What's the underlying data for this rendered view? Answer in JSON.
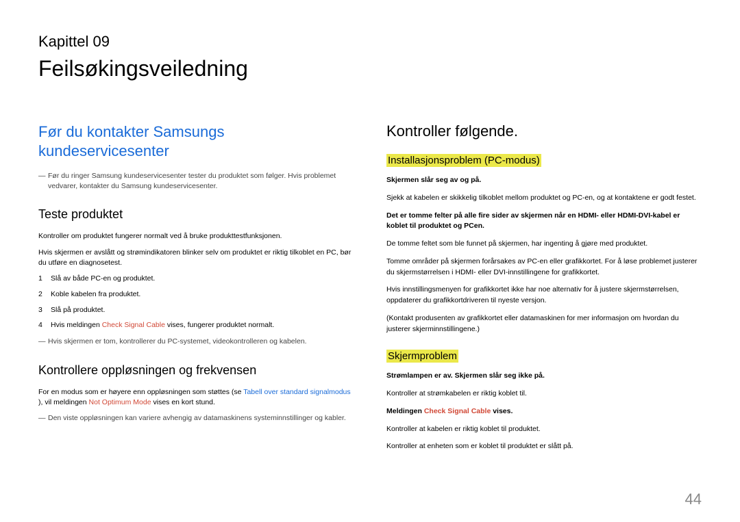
{
  "chapter": "Kapittel 09",
  "title": "Feilsøkingsveiledning",
  "left": {
    "h2": "Før du kontakter Samsungs kundeservicesenter",
    "note1": "Før du ringer Samsung kundeservicesenter tester du produktet som følger. Hvis problemet vedvarer, kontakter du Samsung kundeservicesenter.",
    "h3a": "Teste produktet",
    "p1": "Kontroller om produktet fungerer normalt ved å bruke produkttestfunksjonen.",
    "p2": "Hvis skjermen er avslått og strømindikatoren blinker selv om produktet er riktig tilkoblet en PC, bør du utføre en diagnosetest.",
    "steps": [
      "Slå av både PC-en og produktet.",
      "Koble kabelen fra produktet.",
      "Slå på produktet."
    ],
    "step4_pre": "Hvis meldingen ",
    "step4_red": "Check Signal Cable",
    "step4_post": " vises, fungerer produktet normalt.",
    "note2": "Hvis skjermen er tom, kontrollerer du PC-systemet, videokontrolleren og kabelen.",
    "h3b": "Kontrollere oppløsningen og frekvensen",
    "p3_pre": "For en modus som er høyere enn oppløsningen som støttes (se ",
    "p3_link": "Tabell over standard signalmodus",
    "p3_mid": " ), vil meldingen ",
    "p3_red": "Not Optimum Mode",
    "p3_post": " vises en kort stund.",
    "note3": "Den viste oppløsningen kan variere avhengig av datamaskinens systeminnstillinger og kabler."
  },
  "right": {
    "h2": "Kontroller følgende.",
    "sec1_title": "Installasjonsproblem (PC-modus)",
    "sec1_b1": "Skjermen slår seg av og på.",
    "sec1_p1": "Sjekk at kabelen er skikkelig tilkoblet mellom produktet og PC-en, og at kontaktene er godt festet.",
    "sec1_b2": "Det er tomme felter på alle fire sider av skjermen når en HDMI- eller HDMI-DVI-kabel er koblet til produktet og PCen.",
    "sec1_p2": "De tomme feltet som ble funnet på skjermen, har ingenting å gjøre med produktet.",
    "sec1_p3": "Tomme områder på skjermen forårsakes av PC-en eller grafikkortet. For å løse problemet justerer du skjermstørrelsen i HDMI- eller DVI-innstillingene for grafikkortet.",
    "sec1_p4": "Hvis innstillingsmenyen for grafikkortet ikke har noe alternativ for å justere skjermstørrelsen, oppdaterer du grafikkortdriveren til nyeste versjon.",
    "sec1_p5": "(Kontakt produsenten av grafikkortet eller datamaskinen for mer informasjon om hvordan du justerer skjerminnstillingene.)",
    "sec2_title": "Skjermproblem",
    "sec2_b1": "Strømlampen er av. Skjermen slår seg ikke på.",
    "sec2_p1": "Kontroller at strømkabelen er riktig koblet til.",
    "sec2_b2_pre": "Meldingen ",
    "sec2_b2_red": "Check Signal Cable",
    "sec2_b2_post": " vises.",
    "sec2_p2": "Kontroller at kabelen er riktig koblet til produktet.",
    "sec2_p3": "Kontroller at enheten som er koblet til produktet er slått på."
  },
  "pageno": "44"
}
